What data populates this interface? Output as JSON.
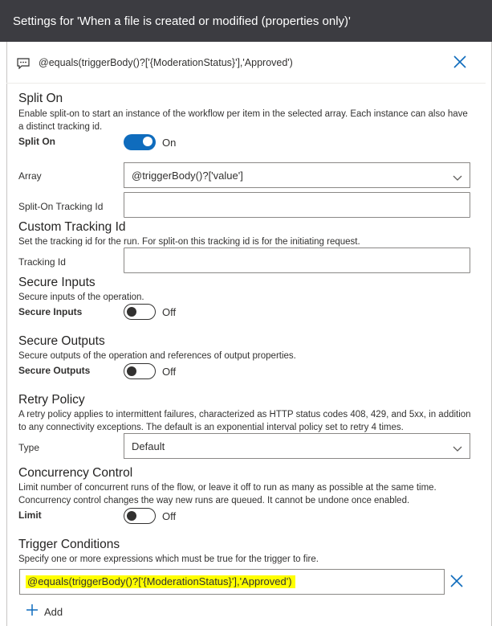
{
  "header": {
    "title": "Settings for 'When a file is created or modified (properties only)'"
  },
  "subheader": {
    "condition_text": "@equals(triggerBody()?['{ModerationStatus}'],'Approved')"
  },
  "split_on": {
    "title": "Split On",
    "description": "Enable split-on to start an instance of the workflow per item in the selected array. Each instance can also have a distinct tracking id.",
    "toggle_label": "Split On",
    "toggle_state": "On",
    "array_label": "Array",
    "array_value": "@triggerBody()?['value']",
    "tracking_label": "Split-On Tracking Id",
    "tracking_value": ""
  },
  "custom_tracking": {
    "title": "Custom Tracking Id",
    "description": "Set the tracking id for the run. For split-on this tracking id is for the initiating request.",
    "tracking_label": "Tracking Id",
    "tracking_value": ""
  },
  "secure_inputs": {
    "title": "Secure Inputs",
    "description": "Secure inputs of the operation.",
    "toggle_label": "Secure Inputs",
    "toggle_state": "Off"
  },
  "secure_outputs": {
    "title": "Secure Outputs",
    "description": "Secure outputs of the operation and references of output properties.",
    "toggle_label": "Secure Outputs",
    "toggle_state": "Off"
  },
  "retry_policy": {
    "title": "Retry Policy",
    "description": "A retry policy applies to intermittent failures, characterized as HTTP status codes 408, 429, and 5xx, in addition to any connectivity exceptions. The default is an exponential interval policy set to retry 4 times.",
    "type_label": "Type",
    "type_value": "Default"
  },
  "concurrency": {
    "title": "Concurrency Control",
    "description": "Limit number of concurrent runs of the flow, or leave it off to run as many as possible at the same time. Concurrency control changes the way new runs are queued. It cannot be undone once enabled.",
    "toggle_label": "Limit",
    "toggle_state": "Off"
  },
  "trigger_conditions": {
    "title": "Trigger Conditions",
    "description": "Specify one or more expressions which must be true for the trigger to fire.",
    "condition_value": "@equals(triggerBody()?['{ModerationStatus}'],'Approved')",
    "add_label": "Add"
  },
  "colors": {
    "header_bg": "#3c3c41",
    "accent": "#0f6cbd",
    "highlight": "#ffff00"
  },
  "icons": [
    "comment-icon",
    "close-icon",
    "chevron-down-icon",
    "remove-icon",
    "plus-icon"
  ]
}
